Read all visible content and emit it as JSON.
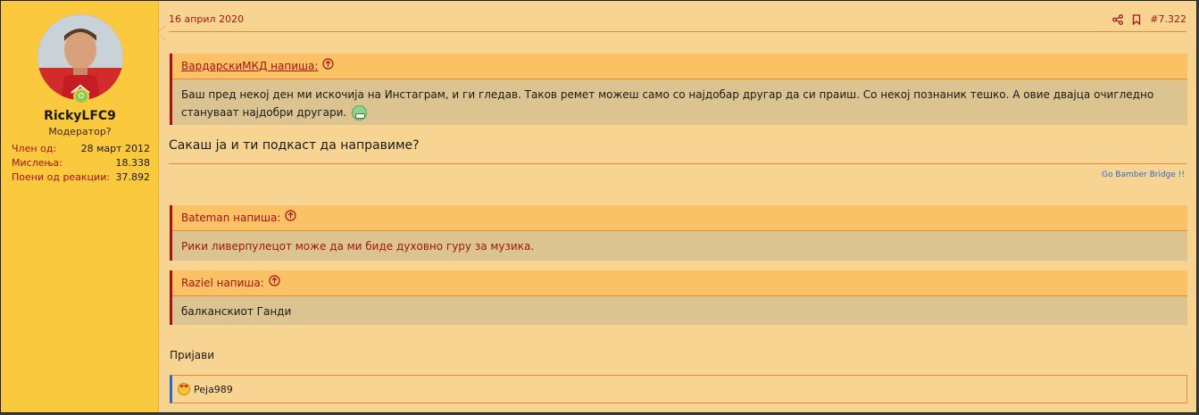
{
  "user": {
    "name": "RickyLFC9",
    "title": "Модератор?",
    "stats": [
      {
        "label": "Член од:",
        "value": "28 март 2012"
      },
      {
        "label": "Мислења:",
        "value": "18.338"
      },
      {
        "label": "Поени од реакции:",
        "value": "37.892"
      }
    ]
  },
  "post": {
    "date": "16 април 2020",
    "number": "#7.322",
    "reply": "Сакаш ја и ти подкаст да направиме?",
    "signature": "Go Bamber Bridge !!",
    "report": "Пријави"
  },
  "quotes": [
    {
      "author": "ВардарскиМКД напиша:",
      "text": "Баш пред некој ден ми искочија на Инстаграм, и ги гледав. Таков ремет можеш само со најдобар другар да си праиш. Со некој познаник тешко. А овие двајца очигледно стануваат најдобри другари."
    },
    {
      "author": "Bateman напиша:",
      "text": "Рики ливерпулецот може да ми биде духовно гуру за музика."
    },
    {
      "author": "Raziel напиша:",
      "text": "балканскиот Ганди"
    }
  ],
  "reactions": {
    "user": "Peja989"
  },
  "colors": {
    "accent": "#a31515",
    "sidebar": "#fbc93d",
    "background": "#f8d492",
    "link": "#2a6ac9"
  }
}
